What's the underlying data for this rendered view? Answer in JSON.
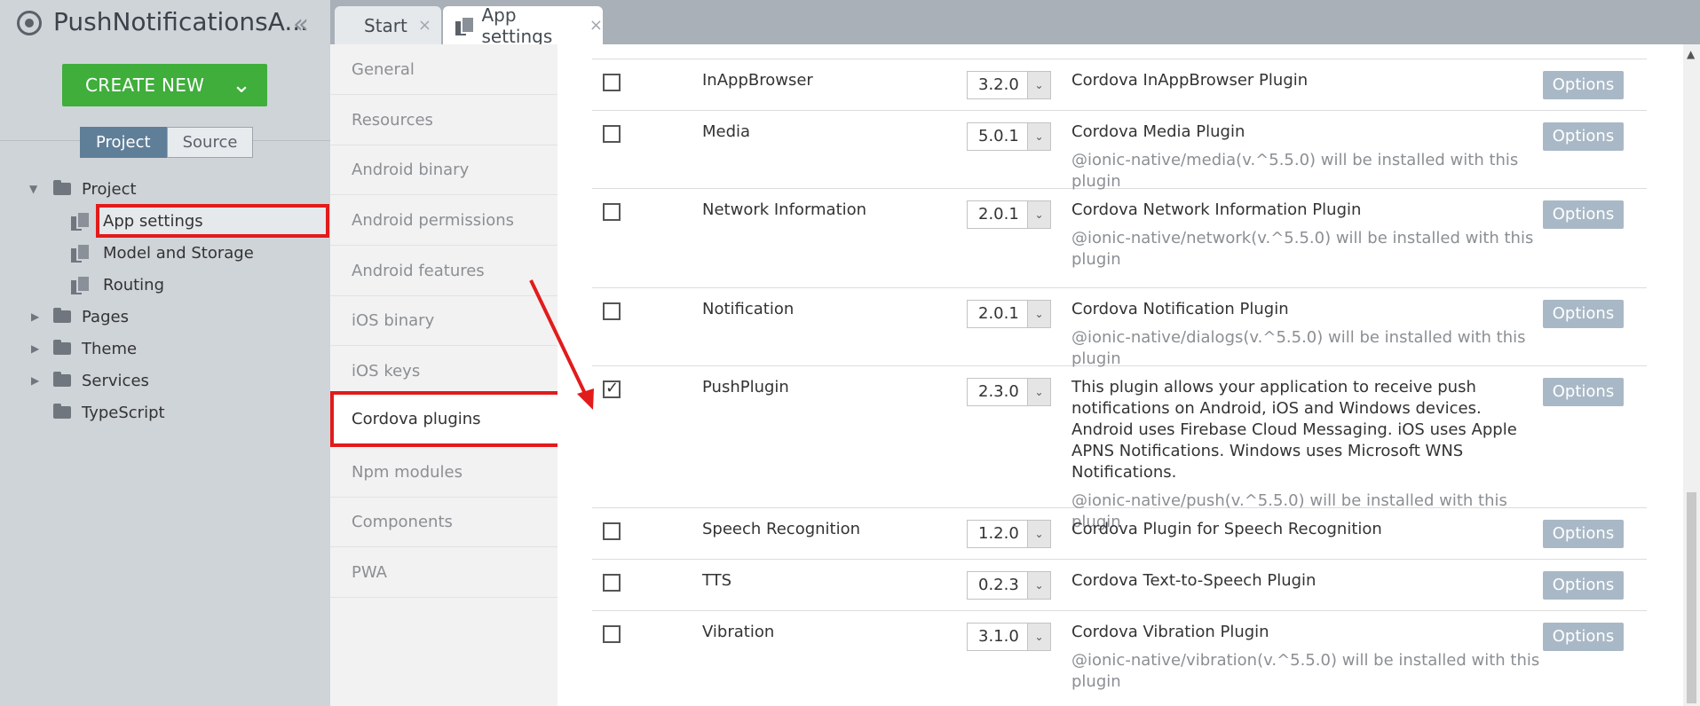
{
  "app": {
    "title": "PushNotificationsA..."
  },
  "sidebar": {
    "create_label": "CREATE NEW",
    "toggle": {
      "project": "Project",
      "source": "Source"
    },
    "tree": [
      {
        "label": "Project",
        "type": "folder",
        "expanded": true
      },
      {
        "label": "App settings",
        "type": "file",
        "selected": true
      },
      {
        "label": "Model and Storage",
        "type": "file"
      },
      {
        "label": "Routing",
        "type": "file"
      },
      {
        "label": "Pages",
        "type": "folder"
      },
      {
        "label": "Theme",
        "type": "folder"
      },
      {
        "label": "Services",
        "type": "folder"
      },
      {
        "label": "TypeScript",
        "type": "folder"
      }
    ]
  },
  "tabs": [
    {
      "label": "Start",
      "close": "×"
    },
    {
      "label": "App settings",
      "close": "×",
      "active": true
    }
  ],
  "settings_nav": [
    "General",
    "Resources",
    "Android binary",
    "Android permissions",
    "Android features",
    "iOS binary",
    "iOS keys",
    "Cordova plugins",
    "Npm modules",
    "Components",
    "PWA"
  ],
  "settings_nav_active": "Cordova plugins",
  "plugins": [
    {
      "name": "InAppBrowser",
      "version": "3.2.0",
      "description": "Cordova InAppBrowser Plugin",
      "note": "",
      "checked": false,
      "options": "Options"
    },
    {
      "name": "Media",
      "version": "5.0.1",
      "description": "Cordova Media Plugin",
      "note": "@ionic-native/media(v.^5.5.0) will be installed with this plugin",
      "checked": false,
      "options": "Options"
    },
    {
      "name": "Network Information",
      "version": "2.0.1",
      "description": "Cordova Network Information Plugin",
      "note": "@ionic-native/network(v.^5.5.0) will be installed with this plugin",
      "checked": false,
      "options": "Options"
    },
    {
      "name": "Notification",
      "version": "2.0.1",
      "description": "Cordova Notification Plugin",
      "note": "@ionic-native/dialogs(v.^5.5.0) will be installed with this plugin",
      "checked": false,
      "options": "Options"
    },
    {
      "name": "PushPlugin",
      "version": "2.3.0",
      "description": "This plugin allows your application to receive push notifications on Android, iOS and Windows devices. Android uses Firebase Cloud Messaging. iOS uses Apple APNS Notifications. Windows uses Microsoft WNS Notifications.",
      "note": "@ionic-native/push(v.^5.5.0) will be installed with this plugin",
      "checked": true,
      "options": "Options"
    },
    {
      "name": "Speech Recognition",
      "version": "1.2.0",
      "description": "Cordova Plugin for Speech Recognition",
      "note": "",
      "checked": false,
      "options": "Options"
    },
    {
      "name": "TTS",
      "version": "0.2.3",
      "description": "Cordova Text-to-Speech Plugin",
      "note": "",
      "checked": false,
      "options": "Options"
    },
    {
      "name": "Vibration",
      "version": "3.1.0",
      "description": "Cordova Vibration Plugin",
      "note": "@ionic-native/vibration(v.^5.5.0) will be installed with this plugin",
      "checked": false,
      "options": "Options"
    }
  ],
  "colors": {
    "accent_green": "#3fae3b",
    "highlight_red": "#e21b1b",
    "options_button": "#a9b8c6"
  }
}
